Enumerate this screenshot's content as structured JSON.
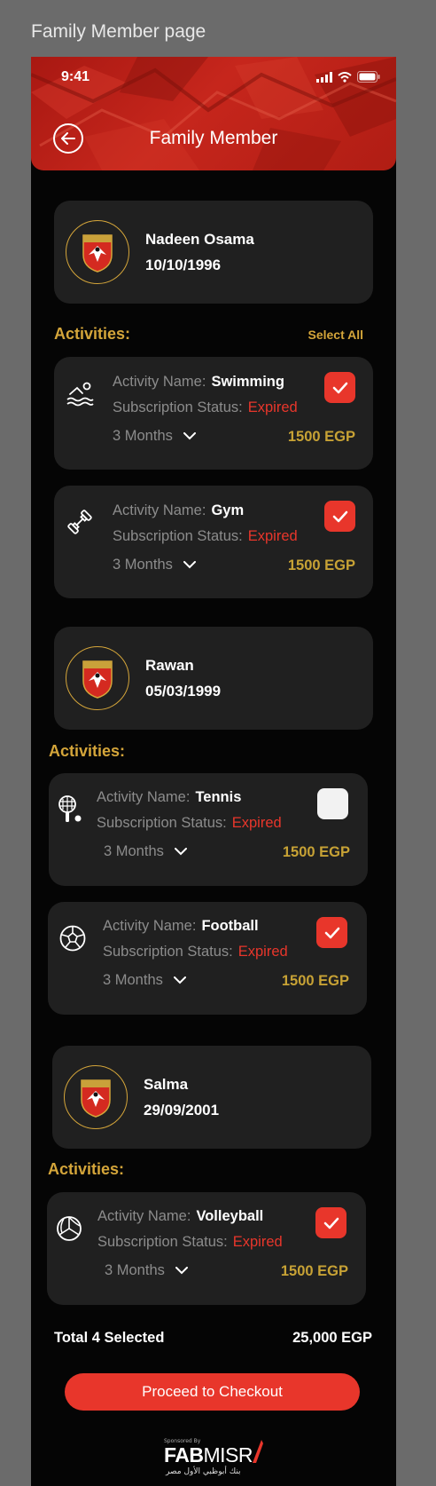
{
  "frame_title": "Family Member page",
  "status_bar": {
    "time": "9:41"
  },
  "header": {
    "title": "Family Member"
  },
  "labels": {
    "activity_name": "Activity Name:",
    "subscription_status": "Subscription Status:",
    "activities": "Activities:",
    "select_all": "Select All"
  },
  "members": [
    {
      "name": "Nadeen Osama",
      "dob": "10/10/1996",
      "activities": [
        {
          "name": "Swimming",
          "status": "Expired",
          "duration": "3 Months",
          "price": "1500 EGP",
          "checked": true,
          "icon": "swimming-icon"
        },
        {
          "name": "Gym",
          "status": "Expired",
          "duration": "3 Months",
          "price": "1500 EGP",
          "checked": true,
          "icon": "dumbbell-icon"
        }
      ]
    },
    {
      "name": "Rawan",
      "dob": "05/03/1999",
      "activities": [
        {
          "name": "Tennis",
          "status": "Expired",
          "duration": "3 Months",
          "price": "1500 EGP",
          "checked": false,
          "icon": "tennis-icon"
        },
        {
          "name": "Football",
          "status": "Expired",
          "duration": "3 Months",
          "price": "1500 EGP",
          "checked": true,
          "icon": "football-icon"
        }
      ]
    },
    {
      "name": "Salma",
      "dob": "29/09/2001",
      "activities": [
        {
          "name": "Volleyball",
          "status": "Expired",
          "duration": "3 Months",
          "price": "1500 EGP",
          "checked": true,
          "icon": "volleyball-icon"
        }
      ]
    }
  ],
  "summary": {
    "total_label": "Total 4 Selected",
    "total_value": "25,000 EGP"
  },
  "checkout_button": "Proceed to Checkout",
  "sponsor": {
    "small": "Sponsored By",
    "brand_bold": "FAB",
    "brand_light": "MISR",
    "arabic": "بنك أبوظبي الأول مصر"
  },
  "colors": {
    "accent_red": "#e8362b",
    "gold": "#d4a53a",
    "card_bg": "#202020",
    "background": "#050505"
  }
}
